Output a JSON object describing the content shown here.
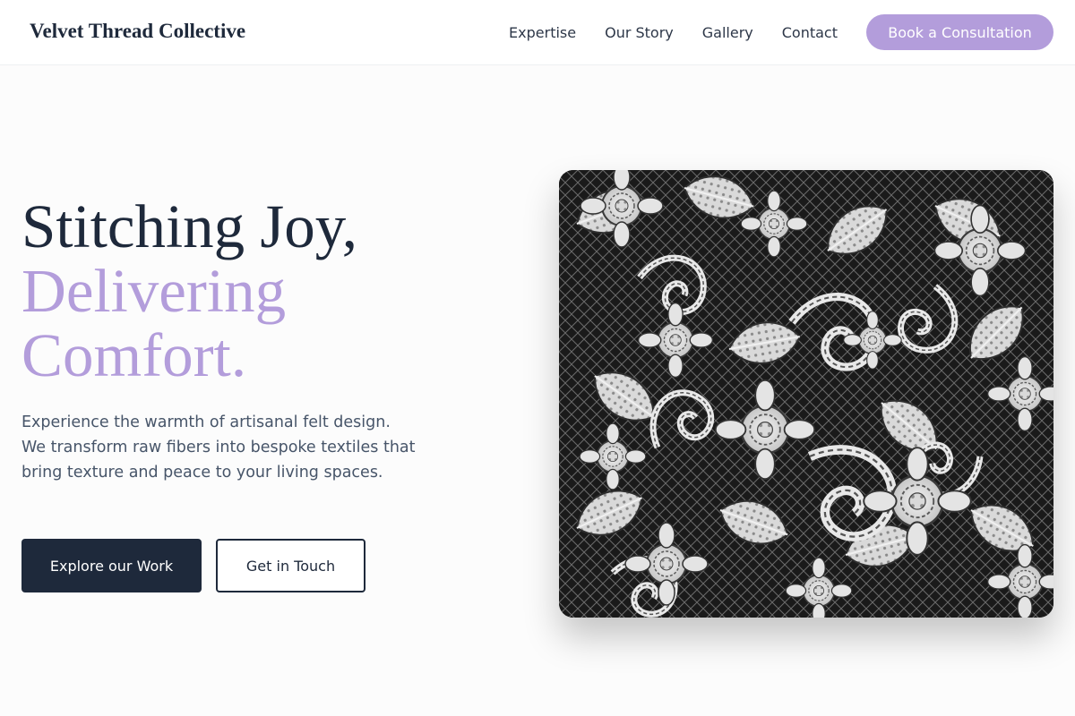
{
  "header": {
    "brand": "Velvet Thread Collective",
    "nav": [
      {
        "label": "Expertise"
      },
      {
        "label": "Our Story"
      },
      {
        "label": "Gallery"
      },
      {
        "label": "Contact"
      }
    ],
    "cta_label": "Book a Consultation"
  },
  "hero": {
    "title_line1": "Stitching Joy,",
    "title_line2": "Delivering",
    "title_line3": "Comfort.",
    "description": "Experience the warmth of artisanal felt design. We transform raw fibers into bespoke textiles that bring texture and peace to your living spaces.",
    "primary_button": "Explore our Work",
    "secondary_button": "Get in Touch",
    "image_icon": "lace-pattern-image"
  },
  "colors": {
    "accent": "#b39ddb",
    "dark": "#1e293b",
    "body_text": "#475569",
    "background": "#fcfcfc"
  }
}
